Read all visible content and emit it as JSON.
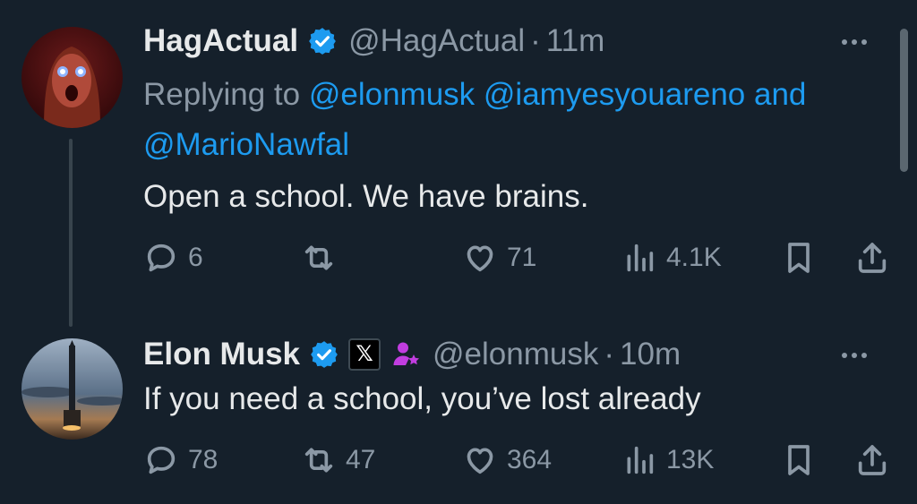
{
  "tweets": [
    {
      "name": "HagActual",
      "handle": "@HagActual",
      "dot": "·",
      "time": "11m",
      "replying_prefix": "Replying to",
      "replying_mentions": [
        "@elonmusk",
        "@iamyesyouareno",
        "@MarioNawfal"
      ],
      "replying_and": "and",
      "text": "Open a school. We have brains.",
      "replies": "6",
      "retweets": "",
      "likes": "71",
      "views": "4.1K"
    },
    {
      "name": "Elon Musk",
      "handle": "@elonmusk",
      "dot": "·",
      "time": "10m",
      "badge_x": "𝕏",
      "text": "If you need a school, you’ve lost already",
      "replies": "78",
      "retweets": "47",
      "likes": "364",
      "views": "13K"
    }
  ],
  "icons": {
    "reply": "reply-icon",
    "retweet": "retweet-icon",
    "like": "heart-icon",
    "views": "views-icon",
    "bookmark": "bookmark-icon",
    "share": "share-icon",
    "verified": "verified-icon",
    "affiliate": "affiliate-icon"
  },
  "colors": {
    "background": "#15202b",
    "accent": "#1d9bf0",
    "secondary_text": "#8b98a5",
    "primary_text": "#e7e9ea",
    "affiliate": "#c13de0"
  }
}
